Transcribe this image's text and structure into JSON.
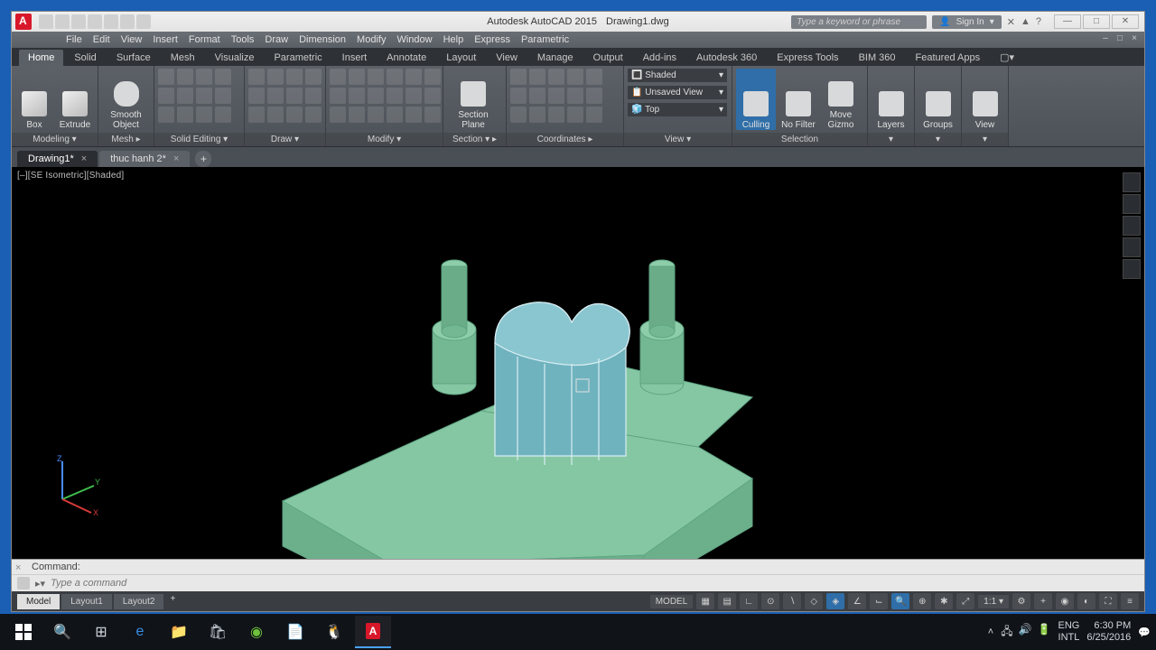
{
  "titlebar": {
    "app_name": "Autodesk AutoCAD 2015",
    "document": "Drawing1.dwg",
    "search_placeholder": "Type a keyword or phrase",
    "signin": "Sign In"
  },
  "menubar": [
    "File",
    "Edit",
    "View",
    "Insert",
    "Format",
    "Tools",
    "Draw",
    "Dimension",
    "Modify",
    "Window",
    "Help",
    "Express",
    "Parametric"
  ],
  "ribbon_tabs": [
    "Home",
    "Solid",
    "Surface",
    "Mesh",
    "Visualize",
    "Parametric",
    "Insert",
    "Annotate",
    "Layout",
    "View",
    "Manage",
    "Output",
    "Add-ins",
    "Autodesk 360",
    "Express Tools",
    "BIM 360",
    "Featured Apps"
  ],
  "ribbon_active_tab": "Home",
  "panels": {
    "modeling": {
      "label": "Modeling ▾",
      "box": "Box",
      "extrude": "Extrude",
      "smooth": "Smooth\nObject"
    },
    "mesh": {
      "label": "Mesh ▸"
    },
    "solid_editing": {
      "label": "Solid Editing ▾"
    },
    "draw": {
      "label": "Draw ▾"
    },
    "modify": {
      "label": "Modify ▾"
    },
    "section": {
      "label": "Section ▾ ▸",
      "plane": "Section\nPlane"
    },
    "coordinates": {
      "label": "Coordinates ▸",
      "shaded": "Shaded",
      "unsaved": "Unsaved View",
      "top": "Top"
    },
    "view": {
      "label": "View ▾"
    },
    "selection": {
      "label": "Selection",
      "culling": "Culling",
      "nofilter": "No Filter",
      "gizmo": "Move\nGizmo"
    },
    "layers": "Layers",
    "groups": "Groups",
    "view_btn": "View"
  },
  "file_tabs": [
    "Drawing1*",
    "thuc hanh 2*"
  ],
  "active_file_tab": 0,
  "viewport_label": "[–][SE Isometric][Shaded]",
  "cmd": {
    "history": "Command:",
    "placeholder": "Type a command"
  },
  "layout_tabs": [
    "Model",
    "Layout1",
    "Layout2"
  ],
  "active_layout_tab": 0,
  "status": {
    "model": "MODEL",
    "scale": "1:1"
  },
  "systray": {
    "lang1": "ENG",
    "lang2": "INTL",
    "time": "6:30 PM",
    "date": "6/25/2016"
  }
}
